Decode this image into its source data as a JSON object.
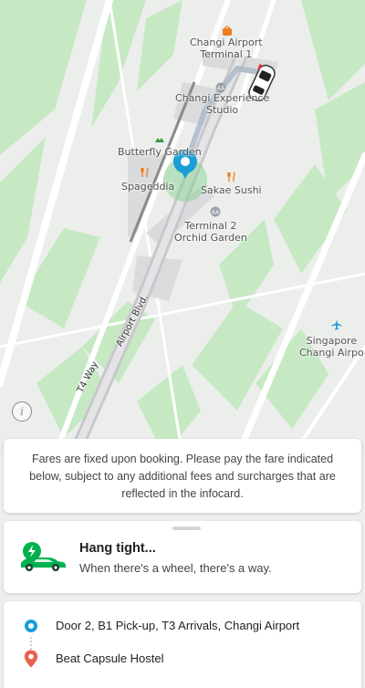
{
  "map": {
    "labels": {
      "changi_airport_terminal1": "Changi Airport\nTerminal 1",
      "changi_experience_studio": "Changi Experience\nStudio",
      "butterfly_garden": "Butterfly Garden",
      "spageddia": "Spageddia",
      "sakae_sushi": "Sakae Sushi",
      "terminal2_orchid_garden": "Terminal 2\nOrchid Garden",
      "singapore_changi_airport": "Singapore\nChangi Airpo"
    },
    "roads": {
      "airport_blvd": "Airport Blvd.",
      "t4_way": "T4 Way"
    },
    "info_button": "i"
  },
  "fare_notice": "Fares are fixed upon booking. Please pay the fare indicated below, subject to any additional fees and surcharges that are reflected in the infocard.",
  "status": {
    "title": "Hang tight...",
    "subtitle": "When there's a wheel, there's a way."
  },
  "route": {
    "pickup": "Door 2, B1 Pick-up, T3 Arrivals, Changi Airport",
    "destination": "Beat Capsule Hostel"
  },
  "colors": {
    "accent": "#1a9ed8",
    "brand_green": "#00b14f",
    "destination_pin": "#e8614d"
  }
}
